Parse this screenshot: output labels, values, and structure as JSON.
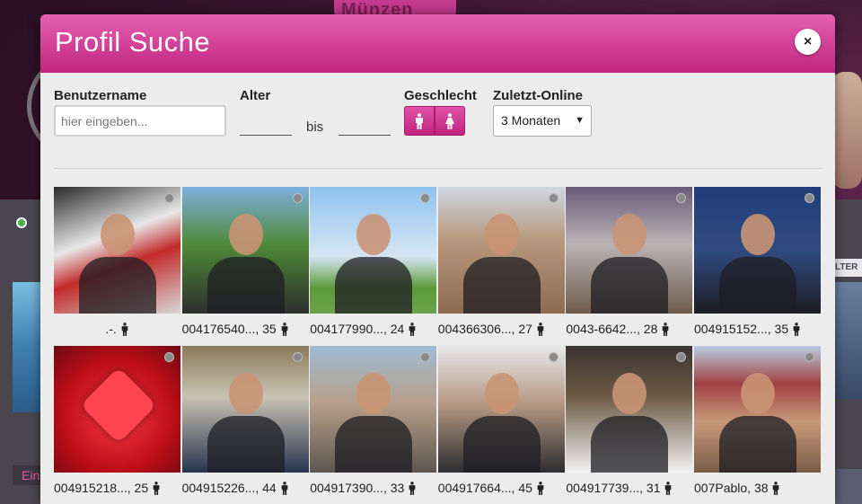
{
  "background": {
    "top_button_label": "Münzen",
    "left_label": "Ein",
    "right_filter_label": "LTER"
  },
  "modal": {
    "title": "Profil Suche",
    "close_label": "×"
  },
  "form": {
    "username_label": "Benutzername",
    "username_placeholder": "hier eingeben...",
    "age_label": "Alter",
    "age_separator": "bis",
    "gender_label": "Geschlecht",
    "gender_options": [
      "male-icon",
      "female-icon"
    ],
    "online_label": "Zuletzt-Online",
    "online_selected": "3 Monaten"
  },
  "colors": {
    "accent": "#d23a95",
    "offline_dot": "#8a8a8a"
  },
  "profiles": [
    {
      "name": ".-.",
      "age": "",
      "gender": "male-icon",
      "online": false,
      "photo_bg": "#c84a4a"
    },
    {
      "name": "004176540...",
      "age": ", 35",
      "gender": "male-icon",
      "online": false,
      "photo_bg": "#5d8a3a"
    },
    {
      "name": "004177990...",
      "age": ", 24",
      "gender": "male-icon",
      "online": false,
      "photo_bg": "#8fc0e8"
    },
    {
      "name": "004366306...",
      "age": ", 27",
      "gender": "male-icon",
      "online": false,
      "photo_bg": "#c9b8a6"
    },
    {
      "name": "0043-6642...",
      "age": ", 28",
      "gender": "male-icon",
      "online": false,
      "photo_bg": "#a7a0a6"
    },
    {
      "name": "004915152...",
      "age": ", 35",
      "gender": "male-icon",
      "online": false,
      "photo_bg": "#2a3f6a"
    },
    {
      "name": "004915218...",
      "age": ", 25",
      "gender": "male-icon",
      "online": false,
      "photo_bg": "#c8101a"
    },
    {
      "name": "004915226...",
      "age": ", 44",
      "gender": "male-icon",
      "online": false,
      "photo_bg": "#7b6a55"
    },
    {
      "name": "004917390...",
      "age": ", 33",
      "gender": "male-icon",
      "online": false,
      "photo_bg": "#9aa6ad"
    },
    {
      "name": "004917664...",
      "age": ", 45",
      "gender": "male-icon",
      "online": false,
      "photo_bg": "#bba38f"
    },
    {
      "name": "004917739...",
      "age": ", 31",
      "gender": "male-icon",
      "online": false,
      "photo_bg": "#3d3a3a"
    },
    {
      "name": "007Pablo",
      "age": ", 38",
      "gender": "male-icon",
      "online": false,
      "photo_bg": "#6c8c4d"
    }
  ]
}
